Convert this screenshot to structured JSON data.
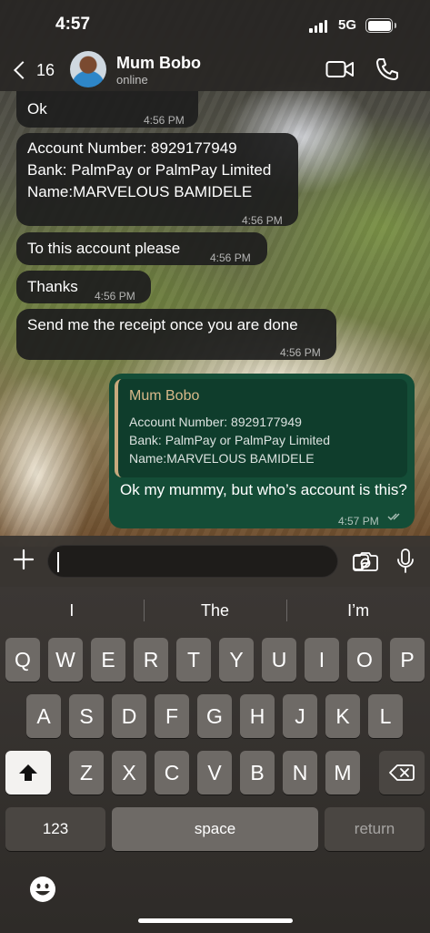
{
  "status_bar": {
    "time": "4:57",
    "network": "5G",
    "battery_level": 1.0
  },
  "header": {
    "back_count": "16",
    "contact_name": "Mum Bobo",
    "contact_status": "online"
  },
  "messages": [
    {
      "direction": "in",
      "text": "Ok",
      "time": "4:56 PM"
    },
    {
      "direction": "in",
      "text": "Account Number: 8929177949\nBank: PalmPay or PalmPay Limited\nName:MARVELOUS BAMIDELE",
      "time": "4:56 PM"
    },
    {
      "direction": "in",
      "text": "To this account please",
      "time": "4:56 PM"
    },
    {
      "direction": "in",
      "text": "Thanks",
      "time": "4:56 PM"
    },
    {
      "direction": "in",
      "text": "Send me the receipt once you are done",
      "time": "4:56 PM"
    },
    {
      "direction": "out",
      "quote_author": "Mum Bobo",
      "quote_text": "Account Number: 8929177949\nBank: PalmPay or PalmPay Limited\nName:MARVELOUS BAMIDELE",
      "text": "Ok my mummy, but who’s account is this?",
      "time": "4:57 PM",
      "status": "read"
    }
  ],
  "input": {
    "value": ""
  },
  "keyboard": {
    "suggestions": [
      "I",
      "The",
      "I’m"
    ],
    "row1": [
      "Q",
      "W",
      "E",
      "R",
      "T",
      "Y",
      "U",
      "I",
      "O",
      "P"
    ],
    "row2": [
      "A",
      "S",
      "D",
      "F",
      "G",
      "H",
      "J",
      "K",
      "L"
    ],
    "row3": [
      "Z",
      "X",
      "C",
      "V",
      "B",
      "N",
      "M"
    ],
    "numbers_label": "123",
    "space_label": "space",
    "return_label": "return"
  },
  "colors": {
    "incoming_bubble": "#1e1e1e",
    "outgoing_bubble": "#144d37",
    "quote_accent": "#c8a97e"
  }
}
